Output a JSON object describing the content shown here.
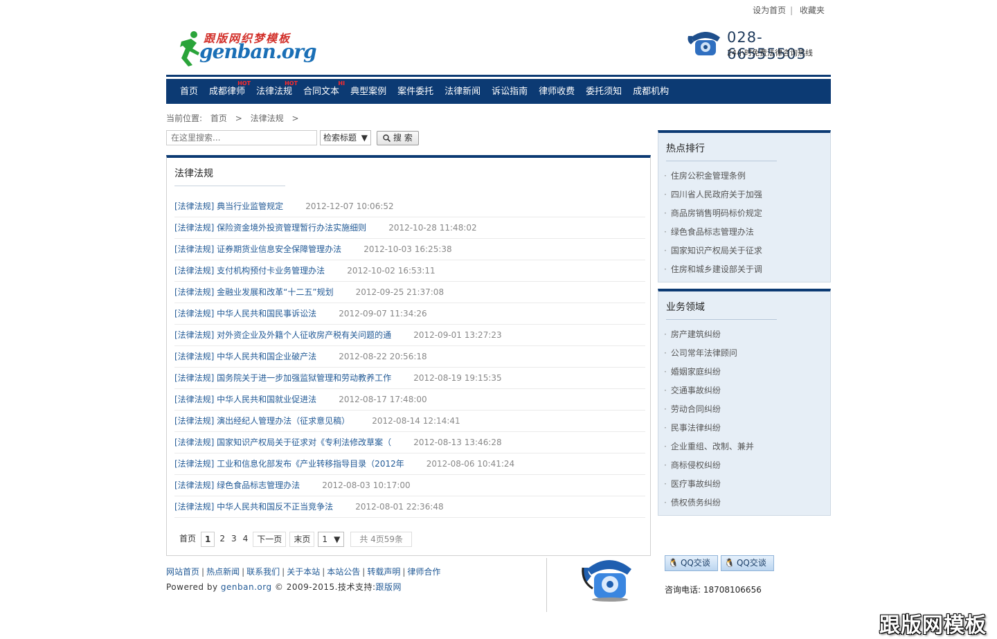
{
  "top_links": {
    "set_home": "设为首页",
    "sep": "|",
    "favorites": "收藏夹"
  },
  "logo": {
    "cn": "跟版网织梦模板",
    "en": "genban.org"
  },
  "hotline": {
    "number": "028-66555503",
    "sub": "24小时免费法律咨询热线"
  },
  "nav": [
    {
      "label": "首页",
      "tag": ""
    },
    {
      "label": "成都律师",
      "tag": "HOT"
    },
    {
      "label": "法律法规",
      "tag": "HOT"
    },
    {
      "label": "合同文本",
      "tag": "HI"
    },
    {
      "label": "典型案例",
      "tag": ""
    },
    {
      "label": "案件委托",
      "tag": ""
    },
    {
      "label": "法律新闻",
      "tag": ""
    },
    {
      "label": "诉讼指南",
      "tag": ""
    },
    {
      "label": "律师收费",
      "tag": ""
    },
    {
      "label": "委托须知",
      "tag": ""
    },
    {
      "label": "成都机构",
      "tag": ""
    }
  ],
  "breadcrumb": {
    "prefix": "当前位置:",
    "home": "首页",
    "sep": ">",
    "current": "法律法规"
  },
  "search": {
    "placeholder": "在这里搜索...",
    "select_value": "检索标题",
    "button": "搜 索"
  },
  "main": {
    "title": "法律法规",
    "items": [
      {
        "title": "[法律法规] 典当行业监管规定",
        "date": "2012-12-07 10:06:52"
      },
      {
        "title": "[法律法规] 保险资金境外投资管理暂行办法实施细则",
        "date": "2012-10-28 11:48:02"
      },
      {
        "title": "[法律法规] 证券期货业信息安全保障管理办法",
        "date": "2012-10-03 16:25:38"
      },
      {
        "title": "[法律法规] 支付机构预付卡业务管理办法",
        "date": "2012-10-02 16:53:11"
      },
      {
        "title": "[法律法规] 金融业发展和改革“十二五”规划",
        "date": "2012-09-25 21:37:08"
      },
      {
        "title": "[法律法规] 中华人民共和国民事诉讼法",
        "date": "2012-09-07 11:34:26"
      },
      {
        "title": "[法律法规] 对外资企业及外籍个人征收房产税有关问题的通",
        "date": "2012-09-01 13:27:23"
      },
      {
        "title": "[法律法规] 中华人民共和国企业破产法",
        "date": "2012-08-22 20:56:18"
      },
      {
        "title": "[法律法规] 国务院关于进一步加强监狱管理和劳动教养工作",
        "date": "2012-08-19 19:15:35"
      },
      {
        "title": "[法律法规] 中华人民共和国就业促进法",
        "date": "2012-08-17 17:48:00"
      },
      {
        "title": "[法律法规] 演出经纪人管理办法（征求意见稿）",
        "date": "2012-08-14 12:14:41"
      },
      {
        "title": "[法律法规] 国家知识产权局关于征求对《专利法修改草案（",
        "date": "2012-08-13 13:46:28"
      },
      {
        "title": "[法律法规] 工业和信息化部发布《产业转移指导目录（2012年",
        "date": "2012-08-06 10:41:24"
      },
      {
        "title": "[法律法规] 绿色食品标志管理办法",
        "date": "2012-08-03 10:17:00"
      },
      {
        "title": "[法律法规] 中华人民共和国反不正当竞争法",
        "date": "2012-08-01 22:36:48"
      }
    ]
  },
  "pager": {
    "first": "首页",
    "pages": [
      "1",
      "2",
      "3",
      "4"
    ],
    "next": "下一页",
    "last": "末页",
    "select_value": "1",
    "total": "共 4页59条"
  },
  "hot_rank": {
    "title": "热点排行",
    "items": [
      "住房公积金管理条例",
      "四川省人民政府关于加强",
      "商品房销售明码标价规定",
      "绿色食品标志管理办法",
      "国家知识产权局关于征求",
      "住房和城乡建设部关于调"
    ]
  },
  "business": {
    "title": "业务领域",
    "items": [
      "房产建筑纠纷",
      "公司常年法律顾问",
      "婚姻家庭纠纷",
      "交通事故纠纷",
      "劳动合同纠纷",
      "民事法律纠纷",
      "企业重组、改制、兼并",
      "商标侵权纠纷",
      "医疗事故纠纷",
      "债权债务纠纷"
    ]
  },
  "footer": {
    "links": [
      "网站首页",
      "热点新闻",
      "联系我们",
      "关于本站",
      "本站公告",
      "转载声明",
      "律师合作"
    ],
    "powered_prefix": "Powered by",
    "powered_link": "genban.org",
    "copyright": "© 2009-2015.技术支持:",
    "support_link": "跟版网",
    "qq1": "QQ交谈",
    "qq2": "QQ交谈",
    "consult": "咨询电话: 18708106656"
  },
  "watermark": "跟版网模板",
  "colors": {
    "nav_bg": "#0c3a73",
    "link": "#225a96",
    "side_bg": "#e6eef6",
    "tag": "#ff2a2a"
  }
}
